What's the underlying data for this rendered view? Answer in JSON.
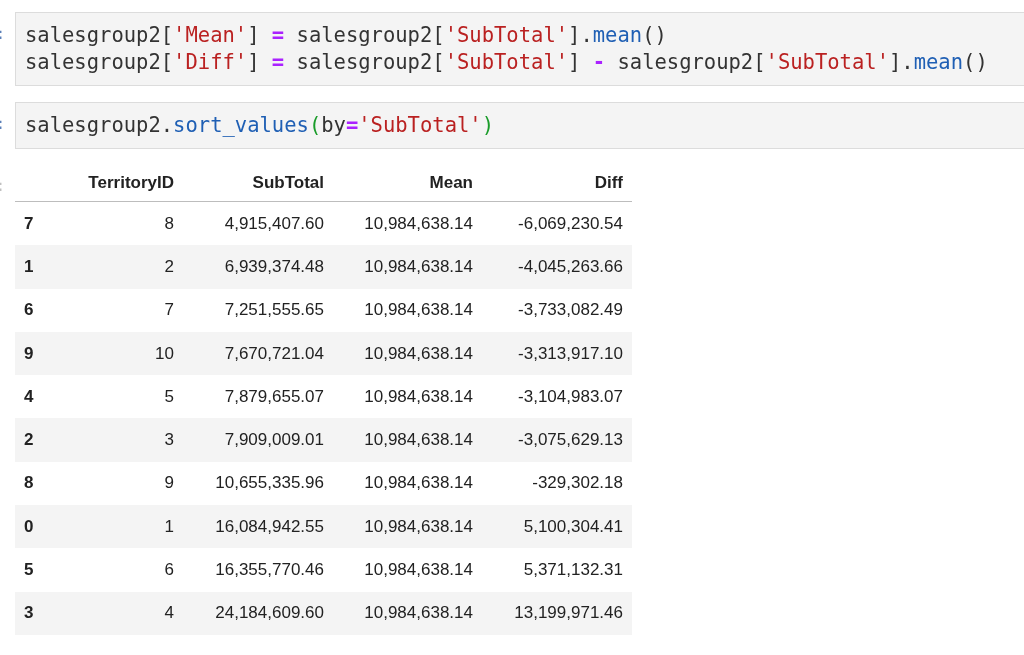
{
  "cells": [
    {
      "prompt": ":",
      "lines": [
        [
          {
            "kind": "plain",
            "text": "salesgroup2["
          },
          {
            "kind": "str",
            "text": "'Mean'"
          },
          {
            "kind": "plain",
            "text": "] "
          },
          {
            "kind": "op",
            "text": "="
          },
          {
            "kind": "plain",
            "text": " salesgroup2["
          },
          {
            "kind": "str",
            "text": "'SubTotal'"
          },
          {
            "kind": "plain",
            "text": "]."
          },
          {
            "kind": "fn",
            "text": "mean"
          },
          {
            "kind": "plain",
            "text": "()"
          }
        ],
        [
          {
            "kind": "plain",
            "text": "salesgroup2["
          },
          {
            "kind": "str",
            "text": "'Diff'"
          },
          {
            "kind": "plain",
            "text": "] "
          },
          {
            "kind": "op",
            "text": "="
          },
          {
            "kind": "plain",
            "text": " salesgroup2["
          },
          {
            "kind": "str",
            "text": "'SubTotal'"
          },
          {
            "kind": "plain",
            "text": "] "
          },
          {
            "kind": "op",
            "text": "-"
          },
          {
            "kind": "plain",
            "text": " salesgroup2["
          },
          {
            "kind": "str",
            "text": "'SubTotal'"
          },
          {
            "kind": "plain",
            "text": "]."
          },
          {
            "kind": "fn",
            "text": "mean"
          },
          {
            "kind": "plain",
            "text": "()"
          }
        ]
      ]
    },
    {
      "prompt": ":",
      "lines": [
        [
          {
            "kind": "plain",
            "text": "salesgroup2."
          },
          {
            "kind": "fn",
            "text": "sort_values"
          },
          {
            "kind": "paren",
            "text": "("
          },
          {
            "kind": "plain",
            "text": "by"
          },
          {
            "kind": "op",
            "text": "="
          },
          {
            "kind": "str",
            "text": "'SubTotal'"
          },
          {
            "kind": "paren",
            "text": ")"
          }
        ]
      ]
    }
  ],
  "output": {
    "prompt": ":",
    "table": {
      "columns": [
        "TerritoryID",
        "SubTotal",
        "Mean",
        "Diff"
      ],
      "rows": [
        {
          "index": "7",
          "cells": [
            "8",
            "4,915,407.60",
            "10,984,638.14",
            "-6,069,230.54"
          ]
        },
        {
          "index": "1",
          "cells": [
            "2",
            "6,939,374.48",
            "10,984,638.14",
            "-4,045,263.66"
          ]
        },
        {
          "index": "6",
          "cells": [
            "7",
            "7,251,555.65",
            "10,984,638.14",
            "-3,733,082.49"
          ]
        },
        {
          "index": "9",
          "cells": [
            "10",
            "7,670,721.04",
            "10,984,638.14",
            "-3,313,917.10"
          ]
        },
        {
          "index": "4",
          "cells": [
            "5",
            "7,879,655.07",
            "10,984,638.14",
            "-3,104,983.07"
          ]
        },
        {
          "index": "2",
          "cells": [
            "3",
            "7,909,009.01",
            "10,984,638.14",
            "-3,075,629.13"
          ]
        },
        {
          "index": "8",
          "cells": [
            "9",
            "10,655,335.96",
            "10,984,638.14",
            "-329,302.18"
          ]
        },
        {
          "index": "0",
          "cells": [
            "1",
            "16,084,942.55",
            "10,984,638.14",
            "5,100,304.41"
          ]
        },
        {
          "index": "5",
          "cells": [
            "6",
            "16,355,770.46",
            "10,984,638.14",
            "5,371,132.31"
          ]
        },
        {
          "index": "3",
          "cells": [
            "4",
            "24,184,609.60",
            "10,984,638.14",
            "13,199,971.46"
          ]
        }
      ]
    }
  }
}
